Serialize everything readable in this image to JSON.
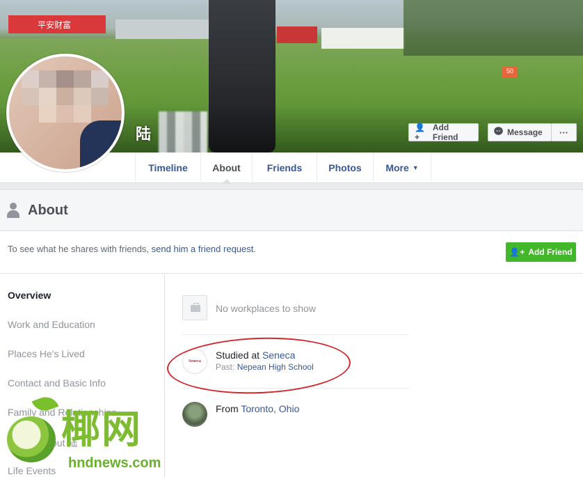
{
  "cover": {
    "banner_text": "平安财富",
    "marker_text": "50"
  },
  "profile": {
    "name": "陆"
  },
  "cover_buttons": {
    "add_friend": "Add Friend",
    "message": "Message",
    "more": "···"
  },
  "tabs": {
    "timeline": "Timeline",
    "about": "About",
    "friends": "Friends",
    "photos": "Photos",
    "more": "More",
    "more_caret": "▼"
  },
  "about": {
    "title": "About",
    "friend_request_prefix": "To see what he shares with friends, ",
    "friend_request_link": "send him a friend request",
    "friend_request_suffix": ".",
    "add_friend_button": "Add Friend"
  },
  "left_nav": {
    "items": [
      {
        "label": "Overview"
      },
      {
        "label": "Work and Education"
      },
      {
        "label": "Places He's Lived"
      },
      {
        "label": "Contact and Basic Info"
      },
      {
        "label": "Family and Relationships"
      },
      {
        "label": "Details About 陆"
      },
      {
        "label": "Life Events"
      }
    ]
  },
  "overview": {
    "no_workplaces": "No workplaces to show",
    "studied_prefix": "Studied at ",
    "studied_school": "Seneca",
    "seneca_logo_text": "Seneca",
    "past_prefix": "Past: ",
    "past_school": "Nepean High School",
    "from_prefix": "From ",
    "from_place": "Toronto, Ohio"
  },
  "watermark": {
    "chinese": "椰网",
    "url": "hndnews.com"
  },
  "colors": {
    "link": "#365899",
    "green_button": "#42b72a",
    "highlight_ellipse": "#d0282e"
  }
}
